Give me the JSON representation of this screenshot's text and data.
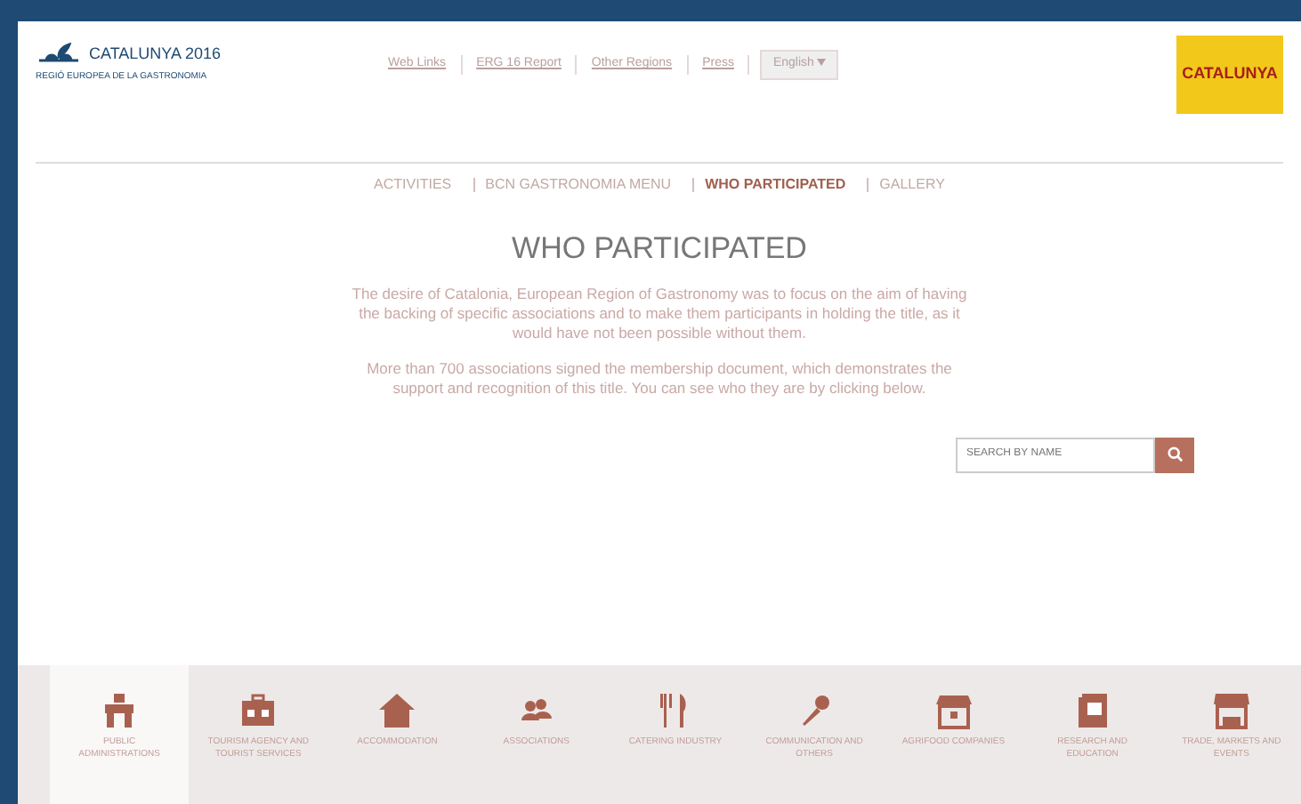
{
  "header": {
    "logo_title": "CATALUNYA 2016",
    "logo_subtitle": "REGIÓ EUROPEA DE LA GASTRONOMIA",
    "links": [
      "Web Links",
      "ERG 16 Report",
      "Other Regions",
      "Press"
    ],
    "language": "English",
    "badge": "CATALUNYA"
  },
  "nav": [
    {
      "label": "ACTIVITIES",
      "selected": false
    },
    {
      "label": "BCN GASTRONOMIA MENU",
      "selected": false
    },
    {
      "label": "WHO PARTICIPATED",
      "selected": true
    },
    {
      "label": "GALLERY",
      "selected": false
    }
  ],
  "title": "WHO PARTICIPATED",
  "paragraphs": [
    "The desire of Catalonia, European Region of Gastronomy was to focus on the aim of having the backing of specific associations and to make them participants in holding the title, as it would have not been possible without them.",
    "More than 700 associations signed the membership document, which demonstrates the support and recognition of this title. You can see who they are by clicking below."
  ],
  "search": {
    "placeholder": "SEARCH BY NAME"
  },
  "categories": [
    {
      "kind": "building",
      "label": "PUBLIC ADMINISTRATIONS",
      "selected": true
    },
    {
      "kind": "suitcase",
      "label": "TOURISM AGENCY AND TOURIST SERVICES",
      "selected": false
    },
    {
      "kind": "house",
      "label": "ACCOMMODATION",
      "selected": false
    },
    {
      "kind": "people",
      "label": "ASSOCIATIONS",
      "selected": false
    },
    {
      "kind": "cutlery",
      "label": "CATERING INDUSTRY",
      "selected": false
    },
    {
      "kind": "microphone",
      "label": "COMMUNICATION AND OTHERS",
      "selected": false
    },
    {
      "kind": "store",
      "label": "AGRIFOOD COMPANIES",
      "selected": false
    },
    {
      "kind": "book",
      "label": "RESEARCH AND EDUCATION",
      "selected": false
    },
    {
      "kind": "market",
      "label": "TRADE, MARKETS AND EVENTS",
      "selected": false
    }
  ]
}
